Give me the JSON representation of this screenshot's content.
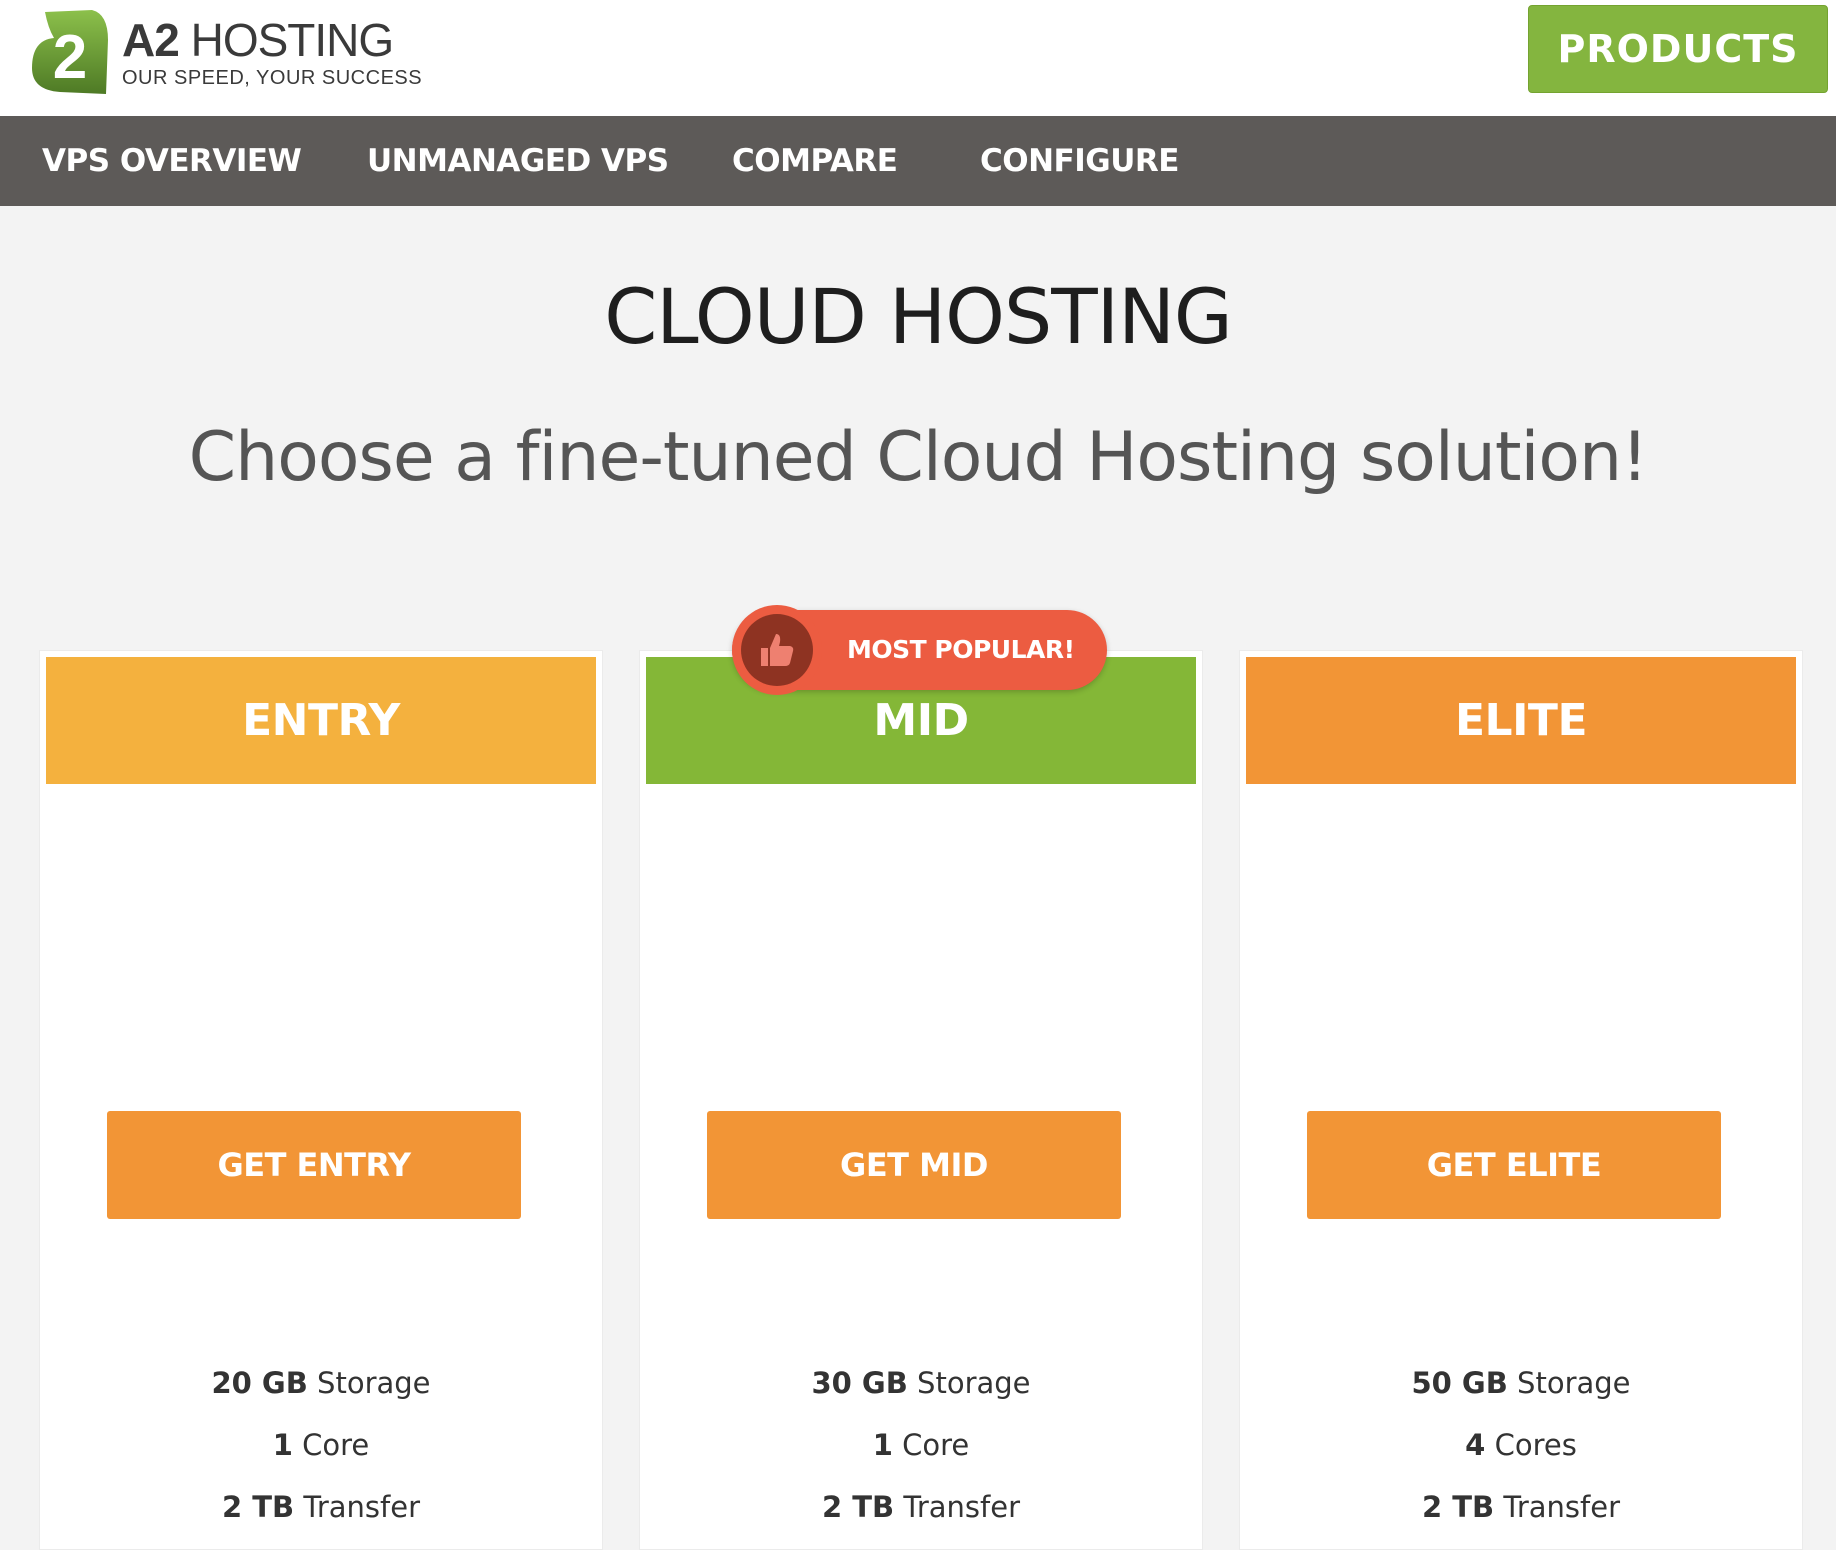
{
  "header": {
    "logo": {
      "brand_bold": "A2",
      "brand_rest": "HOSTING",
      "tagline": "OUR SPEED, YOUR SUCCESS",
      "mark": "2"
    },
    "products_label": "PRODUCTS"
  },
  "nav": {
    "items": [
      {
        "label": "VPS OVERVIEW"
      },
      {
        "label": "UNMANAGED VPS"
      },
      {
        "label": "COMPARE"
      },
      {
        "label": "CONFIGURE"
      }
    ]
  },
  "main": {
    "title": "CLOUD HOSTING",
    "subtitle": "Choose a fine-tuned Cloud Hosting solution!",
    "badge": {
      "label": "MOST POPULAR!",
      "icon": "thumbs-up-icon"
    },
    "plans": [
      {
        "name": "ENTRY",
        "color": "#f4b13e",
        "button": "GET ENTRY",
        "features": [
          {
            "bold": "20 GB",
            "text": " Storage"
          },
          {
            "bold": "1",
            "text": " Core"
          },
          {
            "bold": "2 TB",
            "text": " Transfer"
          }
        ]
      },
      {
        "name": "MID",
        "color": "#84b737",
        "button": "GET MID",
        "features": [
          {
            "bold": "30 GB",
            "text": " Storage"
          },
          {
            "bold": "1",
            "text": " Core"
          },
          {
            "bold": "2 TB",
            "text": " Transfer"
          }
        ]
      },
      {
        "name": "ELITE",
        "color": "#f29536",
        "button": "GET ELITE",
        "features": [
          {
            "bold": "50 GB",
            "text": " Storage"
          },
          {
            "bold": "4",
            "text": " Cores"
          },
          {
            "bold": "2 TB",
            "text": " Transfer"
          }
        ]
      }
    ]
  },
  "colors": {
    "nav_bg": "#5d5a58",
    "products_bg": "#84b53f",
    "button": "#f29536",
    "badge": "#ec5c41"
  }
}
